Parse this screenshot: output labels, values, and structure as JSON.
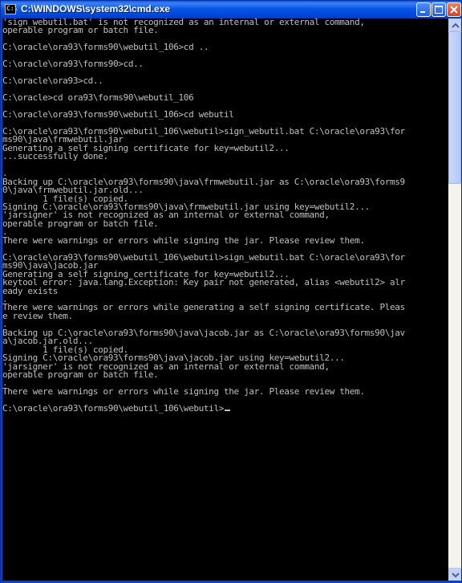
{
  "window": {
    "title": "C:\\WINDOWS\\system32\\cmd.exe",
    "icon": "cmd-icon",
    "controls": [
      "minimize-icon",
      "maximize-icon",
      "close-icon"
    ]
  },
  "colors": {
    "console_background": "#000000",
    "console_text": "#C0C0C0",
    "titlebar": "#0A55E6"
  },
  "console": {
    "text": "'sign_webutil.bat' is not recognized as an internal or external command,\noperable program or batch file.\n\nC:\\oracle\\ora93\\forms90\\webutil_106>cd ..\n\nC:\\oracle\\ora93\\forms90>cd..\n\nC:\\oracle\\ora93>cd..\n\nC:\\oracle>cd ora93\\forms90\\webutil_106\n\nC:\\oracle\\ora93\\forms90\\webutil_106>cd webutil\n\nC:\\oracle\\ora93\\forms90\\webutil_106\\webutil>sign_webutil.bat C:\\oracle\\ora93\\for\nms90\\java\\frmwebutil.jar\nGenerating a self signing certificate for key=webutil2...\n...successfully done.\n\n.\nBacking up C:\\oracle\\ora93\\forms90\\java\\frmwebutil.jar as C:\\oracle\\ora93\\forms9\n0\\java\\frmwebutil.jar.old...\n        1 file(s) copied.\nSigning C:\\oracle\\ora93\\forms90\\java\\frmwebutil.jar using key=webutil2...\n'jarsigner' is not recognized as an internal or external command,\noperable program or batch file.\n.\nThere were warnings or errors while signing the jar. Please review them.\n\nC:\\oracle\\ora93\\forms90\\webutil_106\\webutil>sign_webutil.bat C:\\oracle\\ora93\\for\nms90\\java\\jacob.jar\nGenerating a self signing certificate for key=webutil2...\nkeytool error: java.lang.Exception: Key pair not generated, alias <webutil2> alr\neady exists\n.\nThere were warnings or errors while generating a self signing certificate. Pleas\ne review them.\n.\nBacking up C:\\oracle\\ora93\\forms90\\java\\jacob.jar as C:\\oracle\\ora93\\forms90\\jav\na\\jacob.jar.old...\n        1 file(s) copied.\nSigning C:\\oracle\\ora93\\forms90\\java\\jacob.jar using key=webutil2...\n'jarsigner' is not recognized as an internal or external command,\noperable program or batch file.\n.\nThere were warnings or errors while signing the jar. Please review them.\n\nC:\\oracle\\ora93\\forms90\\webutil_106\\webutil>"
  }
}
